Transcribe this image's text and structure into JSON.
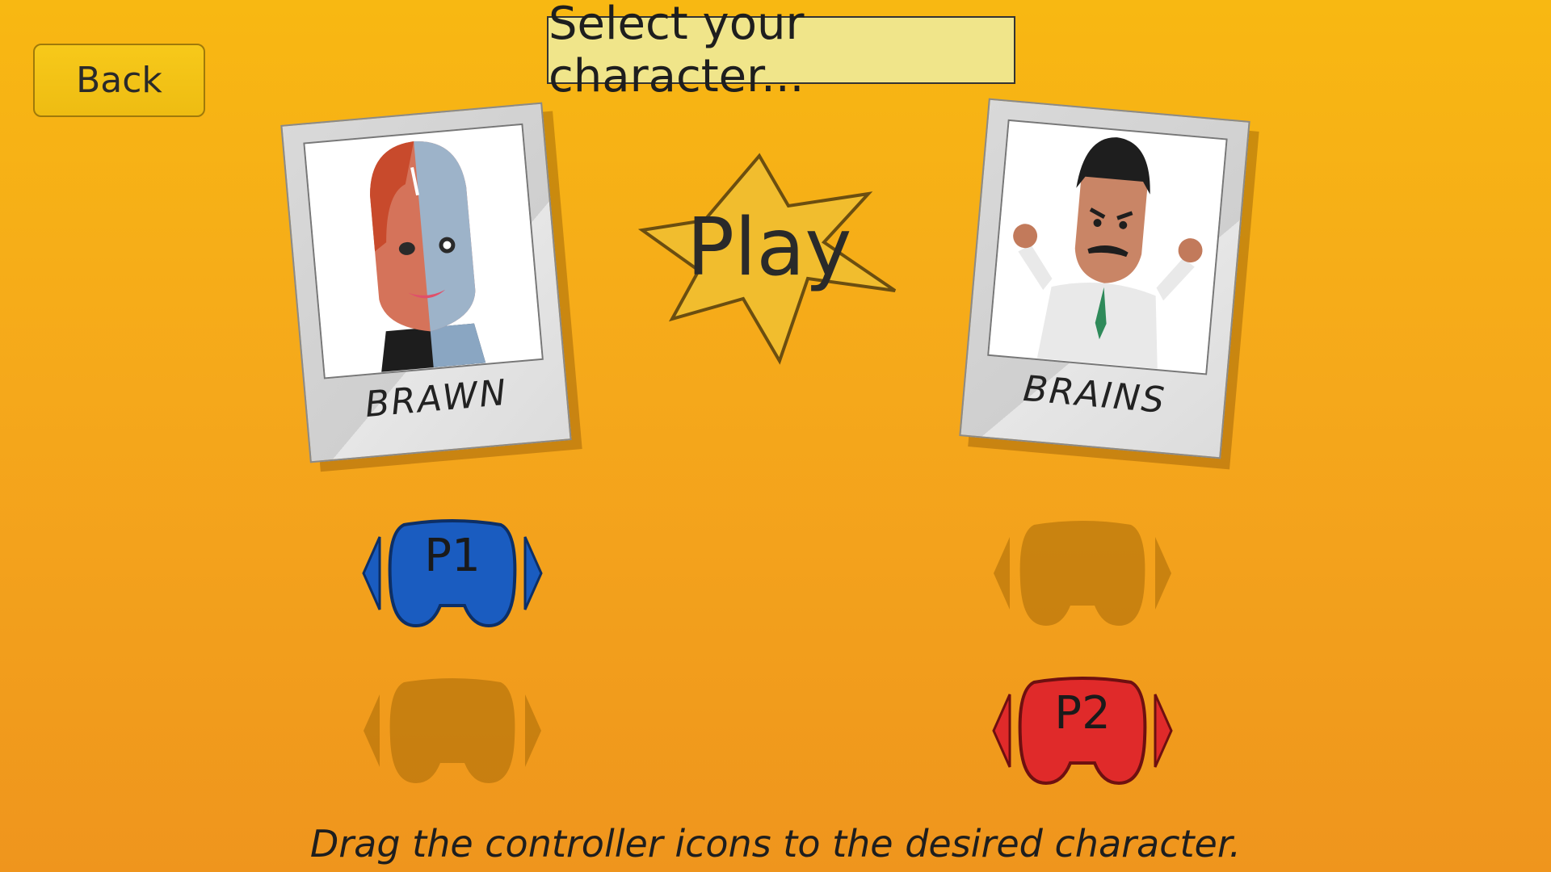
{
  "back_label": "Back",
  "title": "Select your character...",
  "play_label": "Play",
  "characters": [
    {
      "name": "BRAWN"
    },
    {
      "name": "BRAINS"
    }
  ],
  "controllers": {
    "p1": {
      "label": "P1",
      "color": "#1a5cc0"
    },
    "p2": {
      "label": "P2",
      "color": "#e02a2a"
    },
    "slot_color": "#b87812"
  },
  "star_color": "#f1bd2e",
  "hint": "Drag the controller icons to the desired character."
}
